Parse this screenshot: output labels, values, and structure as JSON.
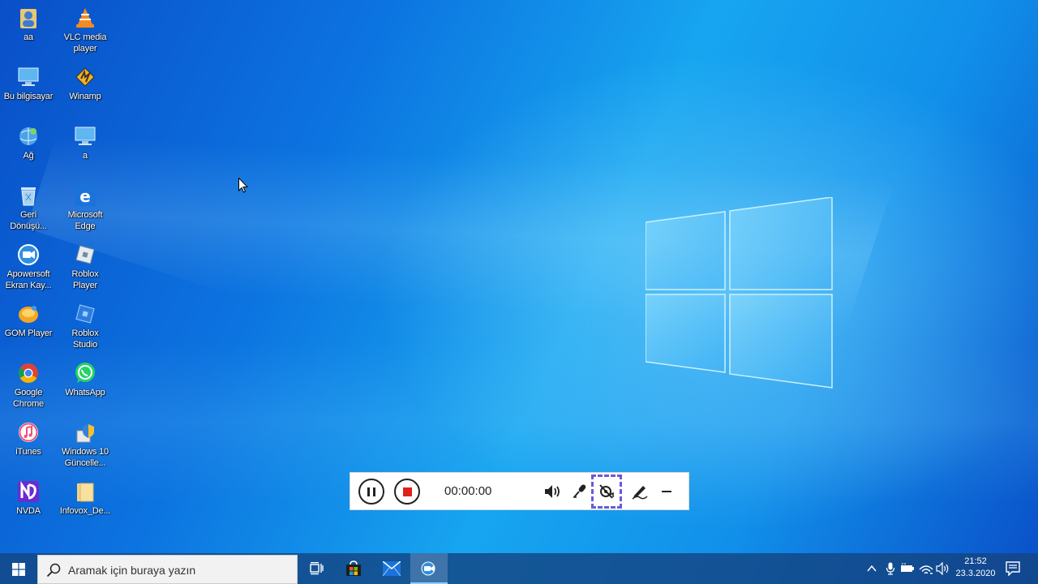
{
  "desktop": {
    "column1": [
      {
        "label": "aa",
        "icon": "user-folder-icon"
      },
      {
        "label": "Bu bilgisayar",
        "icon": "computer-icon"
      },
      {
        "label": "Ağ",
        "icon": "network-icon"
      },
      {
        "label": "Geri\nDönüşü...",
        "icon": "recycle-bin-icon"
      },
      {
        "label": "Apowersoft\nEkran Kay...",
        "icon": "apowersoft-icon"
      },
      {
        "label": "GOM Player",
        "icon": "gom-player-icon"
      },
      {
        "label": "Google\nChrome",
        "icon": "chrome-icon"
      },
      {
        "label": "iTunes",
        "icon": "itunes-icon"
      },
      {
        "label": "NVDA",
        "icon": "nvda-icon"
      }
    ],
    "column2": [
      {
        "label": "VLC media\nplayer",
        "icon": "vlc-icon"
      },
      {
        "label": "Winamp",
        "icon": "winamp-icon"
      },
      {
        "label": "a",
        "icon": "computer-shortcut-icon"
      },
      {
        "label": "Microsoft\nEdge",
        "icon": "edge-icon"
      },
      {
        "label": "Roblox\nPlayer",
        "icon": "roblox-player-icon"
      },
      {
        "label": "Roblox\nStudio",
        "icon": "roblox-studio-icon"
      },
      {
        "label": "WhatsApp",
        "icon": "whatsapp-icon"
      },
      {
        "label": "Windows 10\nGüncelle...",
        "icon": "windows-update-icon"
      },
      {
        "label": "Infovox_De...",
        "icon": "folder-icon"
      }
    ]
  },
  "recorder": {
    "timer": "00:00:00",
    "buttons": [
      "pause",
      "stop",
      "system-sound",
      "microphone",
      "webcam-off",
      "annotate",
      "minimize"
    ]
  },
  "taskbar": {
    "search_placeholder": "Aramak için buraya yazın",
    "apps": [
      "task-view",
      "microsoft-store",
      "mail",
      "screen-recorder"
    ],
    "tray": [
      "chevron-up",
      "microphone",
      "battery",
      "wifi",
      "volume"
    ],
    "time": "21:52",
    "date": "23.3.2020"
  },
  "colors": {
    "wallpaper": "#0c74e0",
    "stop_red": "#e0201b",
    "focus_dash": "#6b5bd6"
  }
}
